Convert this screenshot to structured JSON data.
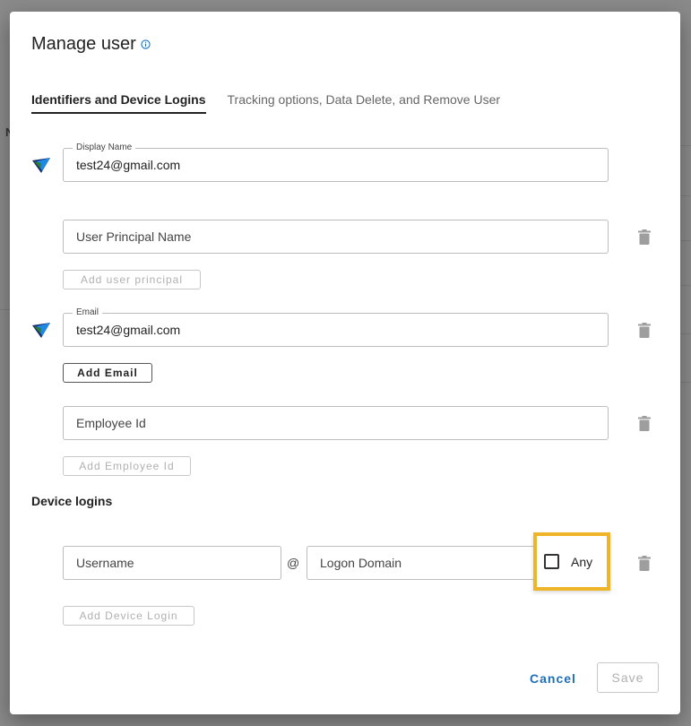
{
  "dialog": {
    "title": "Manage user",
    "tabs": [
      {
        "label": "Identifiers and Device Logins"
      },
      {
        "label": "Tracking options, Data Delete, and Remove User"
      }
    ]
  },
  "identifiers": {
    "display_name": {
      "legend": "Display Name",
      "value": "test24@gmail.com"
    },
    "user_principal": {
      "placeholder": "User Principal Name",
      "add_label": "Add user principal"
    },
    "email": {
      "legend": "Email",
      "value": "test24@gmail.com",
      "add_label": "Add Email"
    },
    "employee_id": {
      "placeholder": "Employee Id",
      "add_label": "Add Employee Id"
    }
  },
  "device_logins": {
    "title": "Device logins",
    "username_placeholder": "Username",
    "at_symbol": "@",
    "domain_placeholder": "Logon Domain",
    "any_label": "Any",
    "any_checked": false,
    "add_label": "Add Device Login"
  },
  "footer": {
    "cancel_label": "Cancel",
    "save_label": "Save"
  },
  "background": {
    "partial_char": "N"
  },
  "colors": {
    "accent": "#1e6fb7",
    "highlight": "#f0b429",
    "disabled": "#b0b0b0"
  }
}
